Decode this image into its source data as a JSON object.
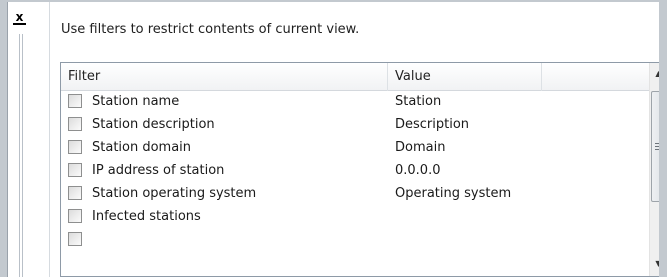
{
  "hint_text": "Use filters to restrict contents of current view.",
  "close_glyph": "x",
  "table": {
    "columns": [
      "Filter",
      "Value",
      ""
    ],
    "rows": [
      {
        "filter": "Station name",
        "value": "Station",
        "checked": false
      },
      {
        "filter": "Station description",
        "value": "Description",
        "checked": false
      },
      {
        "filter": "Station domain",
        "value": "Domain",
        "checked": false
      },
      {
        "filter": "IP address of station",
        "value": "0.0.0.0",
        "checked": false
      },
      {
        "filter": "Station operating system",
        "value": "Operating system",
        "checked": false
      },
      {
        "filter": "Infected stations",
        "value": "",
        "checked": false
      },
      {
        "filter": "",
        "value": "",
        "checked": false
      }
    ]
  },
  "scrollbar": {
    "up_glyph": "▲",
    "down_glyph": "▼"
  }
}
